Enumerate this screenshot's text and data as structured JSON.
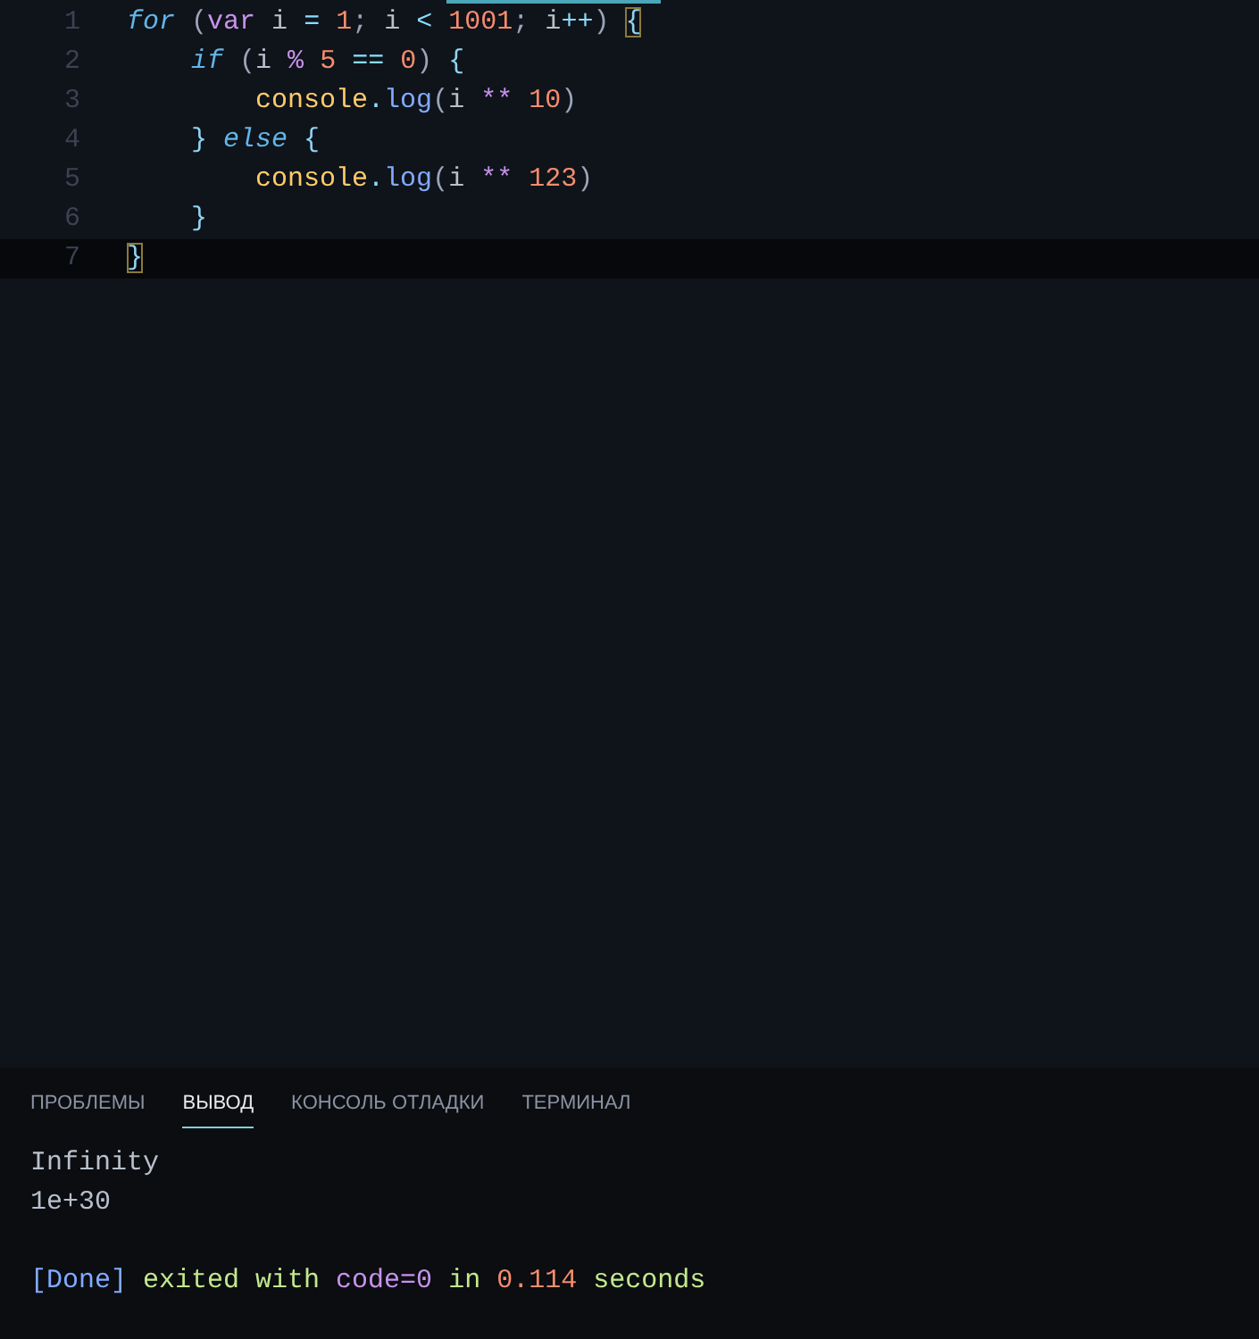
{
  "editor": {
    "lines": [
      {
        "number": "1",
        "current": false,
        "tokens": [
          {
            "kind": "keyword",
            "text": "for"
          },
          {
            "kind": "punct",
            "text": " ("
          },
          {
            "kind": "storage",
            "text": "var"
          },
          {
            "kind": "variable",
            "text": " i "
          },
          {
            "kind": "operator",
            "text": "="
          },
          {
            "kind": "number",
            "text": " 1"
          },
          {
            "kind": "punct",
            "text": "; "
          },
          {
            "kind": "variable",
            "text": "i "
          },
          {
            "kind": "operator",
            "text": "<"
          },
          {
            "kind": "number",
            "text": " 1001"
          },
          {
            "kind": "punct",
            "text": "; "
          },
          {
            "kind": "variable",
            "text": "i"
          },
          {
            "kind": "operator",
            "text": "++"
          },
          {
            "kind": "punct",
            "text": ") "
          },
          {
            "kind": "brace",
            "text": "{",
            "matched": true
          }
        ]
      },
      {
        "number": "2",
        "current": false,
        "tokens": [
          {
            "kind": "keyword",
            "text": "    if"
          },
          {
            "kind": "punct",
            "text": " ("
          },
          {
            "kind": "variable",
            "text": "i "
          },
          {
            "kind": "storage",
            "text": "%"
          },
          {
            "kind": "number",
            "text": " 5 "
          },
          {
            "kind": "operator",
            "text": "=="
          },
          {
            "kind": "number",
            "text": " 0"
          },
          {
            "kind": "punct",
            "text": ") "
          },
          {
            "kind": "brace",
            "text": "{",
            "matched": false
          }
        ]
      },
      {
        "number": "3",
        "current": false,
        "tokens": [
          {
            "kind": "object",
            "text": "        console"
          },
          {
            "kind": "operator",
            "text": "."
          },
          {
            "kind": "function",
            "text": "log"
          },
          {
            "kind": "punct",
            "text": "("
          },
          {
            "kind": "variable",
            "text": "i "
          },
          {
            "kind": "storage",
            "text": "**"
          },
          {
            "kind": "number",
            "text": " 10"
          },
          {
            "kind": "punct",
            "text": ")"
          }
        ]
      },
      {
        "number": "4",
        "current": false,
        "tokens": [
          {
            "kind": "brace",
            "text": "    }",
            "matched": false
          },
          {
            "kind": "keyword",
            "text": " else "
          },
          {
            "kind": "brace",
            "text": "{",
            "matched": false
          }
        ]
      },
      {
        "number": "5",
        "current": false,
        "tokens": [
          {
            "kind": "object",
            "text": "        console"
          },
          {
            "kind": "operator",
            "text": "."
          },
          {
            "kind": "function",
            "text": "log"
          },
          {
            "kind": "punct",
            "text": "("
          },
          {
            "kind": "variable",
            "text": "i "
          },
          {
            "kind": "storage",
            "text": "**"
          },
          {
            "kind": "number",
            "text": " 123"
          },
          {
            "kind": "punct",
            "text": ")"
          }
        ]
      },
      {
        "number": "6",
        "current": false,
        "tokens": [
          {
            "kind": "brace",
            "text": "    }",
            "matched": false
          }
        ]
      },
      {
        "number": "7",
        "current": true,
        "tokens": [
          {
            "kind": "brace",
            "text": "}",
            "matched": true
          }
        ]
      }
    ]
  },
  "panel": {
    "tabs": [
      {
        "label": "ПРОБЛЕМЫ",
        "selected": false
      },
      {
        "label": "ВЫВОД",
        "selected": true
      },
      {
        "label": "КОНСОЛЬ ОТЛАДКИ",
        "selected": false
      },
      {
        "label": "ТЕРМИНАЛ",
        "selected": false
      }
    ],
    "output": [
      {
        "kind": "log",
        "tokens": [
          {
            "kind": "plain",
            "text": "Infinity"
          }
        ]
      },
      {
        "kind": "log",
        "tokens": [
          {
            "kind": "plain",
            "text": "1e+30"
          }
        ]
      },
      {
        "kind": "status",
        "tokens": [
          {
            "kind": "done",
            "text": "[Done]"
          },
          {
            "kind": "green",
            "text": " exited with "
          },
          {
            "kind": "code",
            "text": "code=0"
          },
          {
            "kind": "green",
            "text": " in "
          },
          {
            "kind": "number",
            "text": "0.114"
          },
          {
            "kind": "green",
            "text": " seconds"
          }
        ]
      }
    ]
  }
}
